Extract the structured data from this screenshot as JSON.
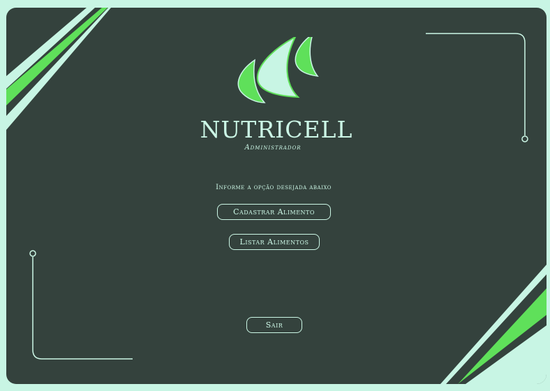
{
  "brand": {
    "name": "NUTRICELL",
    "role": "Administrador"
  },
  "prompt": "Informe a opção desejada abaixo",
  "buttons": {
    "register_food": "Cadastrar Alimento",
    "list_foods": "Listar Alimentos",
    "exit": "Sair"
  },
  "icons": {
    "logo": "leaf-logo-icon"
  },
  "colors": {
    "page_background": "#c8f5e4",
    "card_background": "#34423d",
    "text": "#ccf7e6",
    "accent_green": "#5fe05a",
    "accent_mint": "#ccf7e6"
  }
}
